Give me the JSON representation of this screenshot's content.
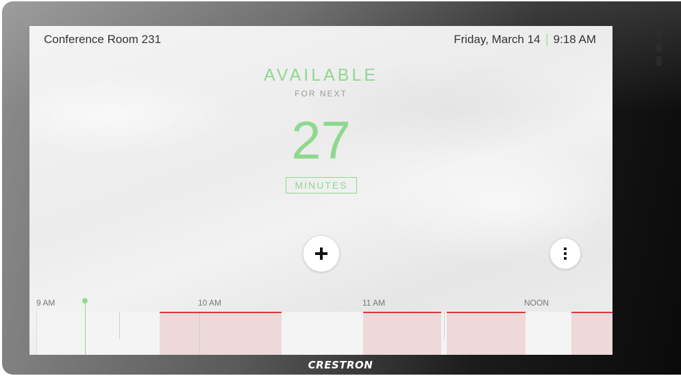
{
  "device": {
    "brand": "CRESTRON"
  },
  "header": {
    "room_name": "Conference Room 231",
    "date": "Friday, March 14",
    "time": "9:18 AM"
  },
  "status": {
    "label": "AVAILABLE",
    "sublabel": "FOR NEXT",
    "remaining_value": "27",
    "remaining_unit": "MINUTES"
  },
  "actions": {
    "add_icon": "plus-icon",
    "more_icon": "more-vertical-icon"
  },
  "timeline": {
    "labels": [
      "9 AM",
      "10 AM",
      "11 AM",
      "NOON"
    ],
    "current_time": "9:18 AM",
    "reserved_color": "#edd9d9",
    "reserved_edge_color": "#d93a3a",
    "available_color": "#f4f4f4",
    "accent_color": "#8fd88f"
  }
}
